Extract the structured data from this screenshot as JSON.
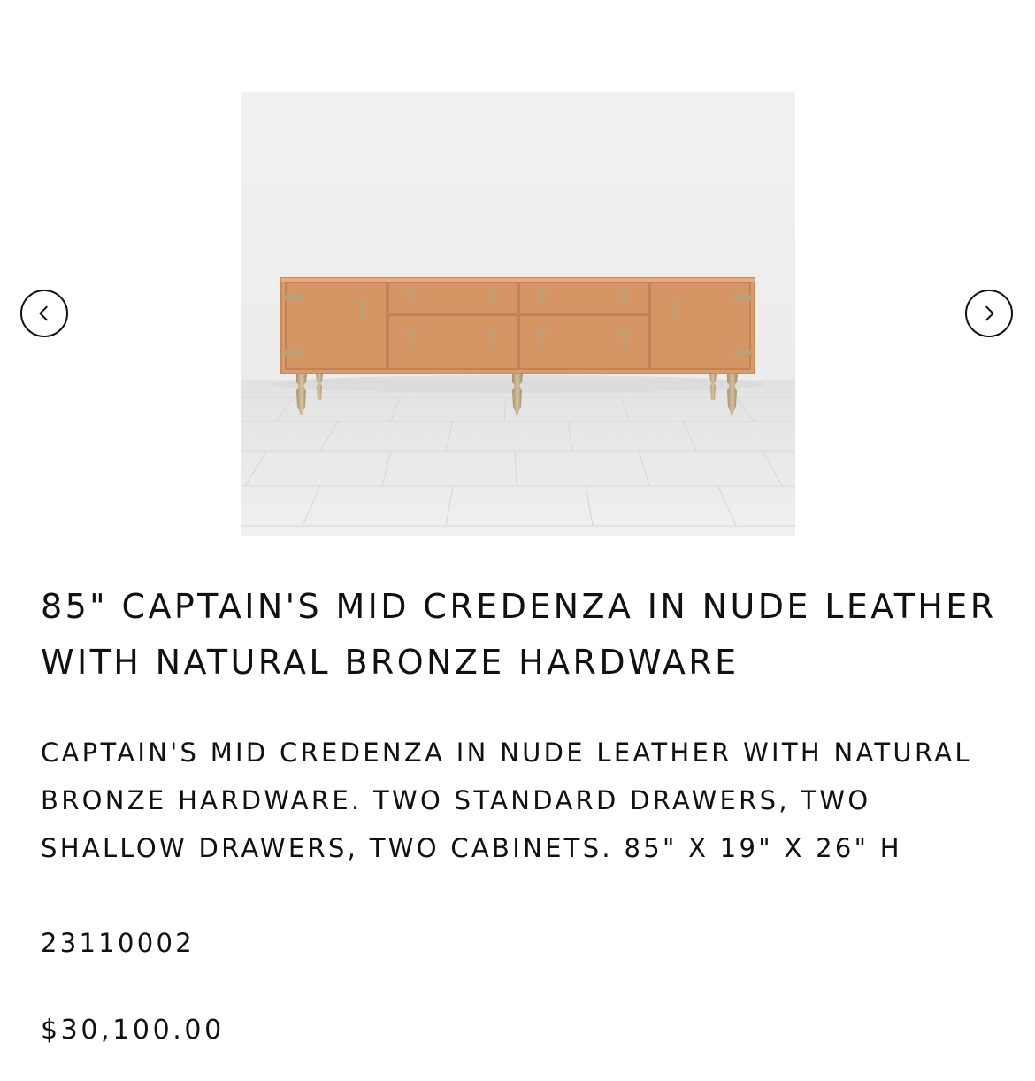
{
  "carousel": {
    "prev_icon": "chevron-left-icon",
    "next_icon": "chevron-right-icon",
    "image_alt": "Captain's Mid Credenza in Nude Leather"
  },
  "product": {
    "title": "85\" CAPTAIN'S MID CREDENZA IN NUDE LEATHER WITH NATURAL BRONZE HARDWARE",
    "description": "CAPTAIN'S MID CREDENZA IN NUDE LEATHER WITH NATURAL BRONZE HARDWARE. TWO STANDARD DRAWERS, TWO SHALLOW DRAWERS, TWO CABINETS. 85\" X 19\" X 26\" H",
    "sku": "23110002",
    "price": "$30,100.00"
  },
  "colors": {
    "leather": "#d99a6c",
    "bronze": "#b8a27a",
    "text": "#111111"
  }
}
